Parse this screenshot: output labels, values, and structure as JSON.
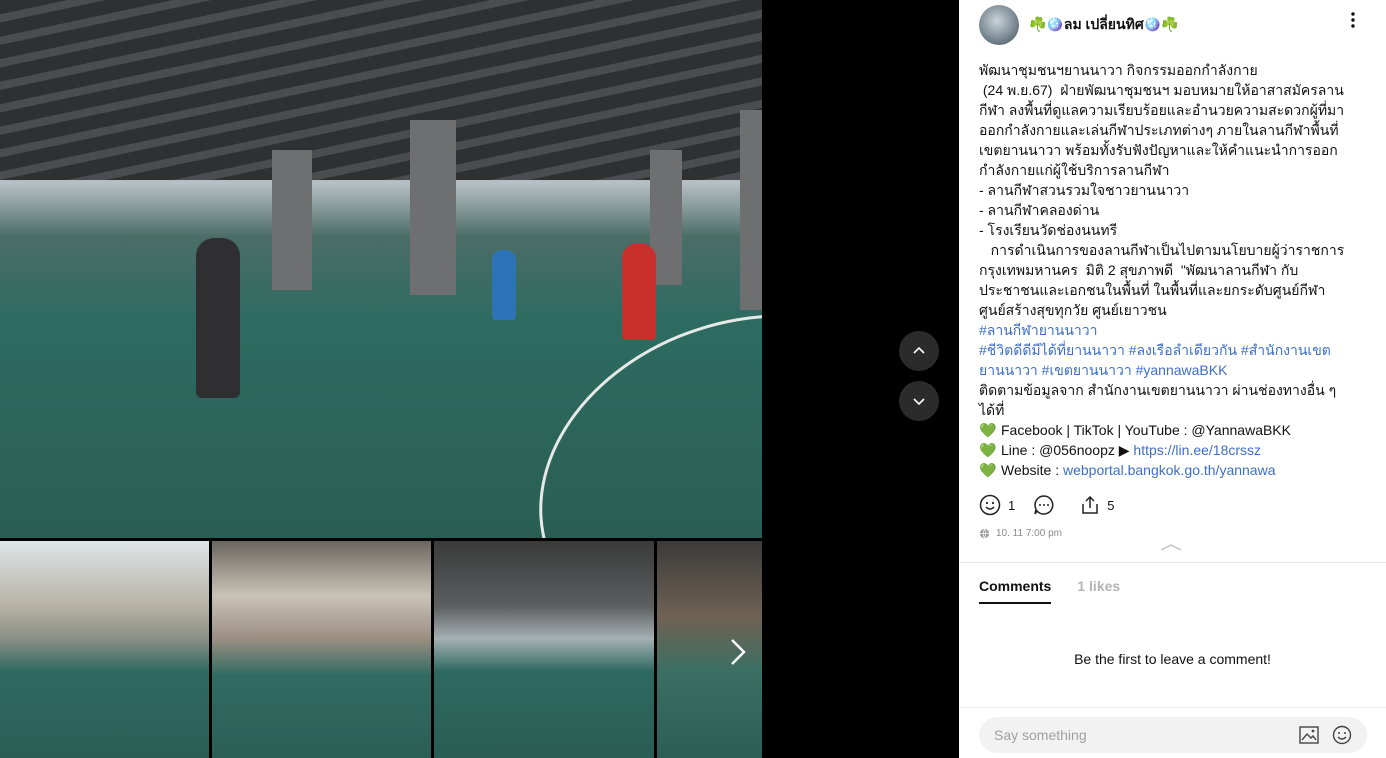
{
  "post": {
    "author": "☘️🪩ลม เปลี่ยนทิศ🪩☘️",
    "caption_lines": [
      "พัฒนาชุมชนฯยานนาวา กิจกรรมออกกำลังกาย",
      " (24 พ.ย.67)  ฝ่ายพัฒนาชุมชนฯ มอบหมายให้อาสาสมัครลานกีฬา ลงพื้นที่ดูแลความเรียบร้อยและอำนวยความสะดวกผู้ที่มาออกกำลังกายและเล่นกีฬาประเภทต่างๆ ภายในลานกีฬาพื้นที่เขตยานนาวา พร้อมทั้งรับฟังปัญหาและให้คำแนะนำการออกกำลังกายแก่ผู้ใช้บริการลานกีฬา",
      "- ลานกีฬาสวนรวมใจชาวยานนาวา",
      "- ลานกีฬาคลองด่าน",
      "- โรงเรียนวัดช่องนนทรี",
      "   การดำเนินการของลานกีฬาเป็นไปตามนโยบายผู้ว่าราชการกรุงเทพมหานคร  มิติ 2 สุขภาพดี  \"พัฒนาลานกีฬา กับประชาชนและเอกชนในพื้นที่ ในพื้นที่และยกระดับศูนย์กีฬา ศูนย์สร้างสุขทุกวัย ศูนย์เยาวชน"
    ],
    "hashtag_line1": "#ลานกีฬายานนาวา",
    "hashtag_line2": "#ชีวิตดีดีมีได้ที่ยานนาวา #ลงเรือลำเดียวกัน #สำนักงานเขตยานนาวา #เขตยานนาวา #yannawaBKK",
    "follow_text": "ติดตามข้อมูลจาก สำนักงานเขตยานนาวา ผ่านช่องทางอื่น ๆ ได้ที่",
    "heart_icon": "💚",
    "social_line": "Facebook | TikTok | YouTube : @YannawaBKK",
    "line_prefix": "Line : @056noopz ▶ ",
    "line_url": "https://lin.ee/18crssz",
    "website_prefix": "Website : ",
    "website_url": "webportal.bangkok.go.th/yannawa",
    "reaction_count": "1",
    "share_count": "5",
    "date": "10. 11 7:00 pm"
  },
  "comments": {
    "tab_comments": "Comments",
    "tab_likes": "1 likes",
    "empty_text": "Be the first to leave a comment!",
    "input_placeholder": "Say something"
  },
  "icons": {
    "nav_up": "chevron-up-icon",
    "nav_down": "chevron-down-icon",
    "next": "chevron-right-icon",
    "kebab": "more-vertical-icon",
    "reaction": "smile-icon",
    "comment": "comment-icon",
    "share": "share-icon",
    "globe": "globe-icon",
    "image": "image-icon",
    "emoji": "emoji-icon"
  },
  "colors": {
    "accent_link": "#3e6fc8",
    "heart": "#1fcf7a",
    "court": "#2d6b60"
  }
}
